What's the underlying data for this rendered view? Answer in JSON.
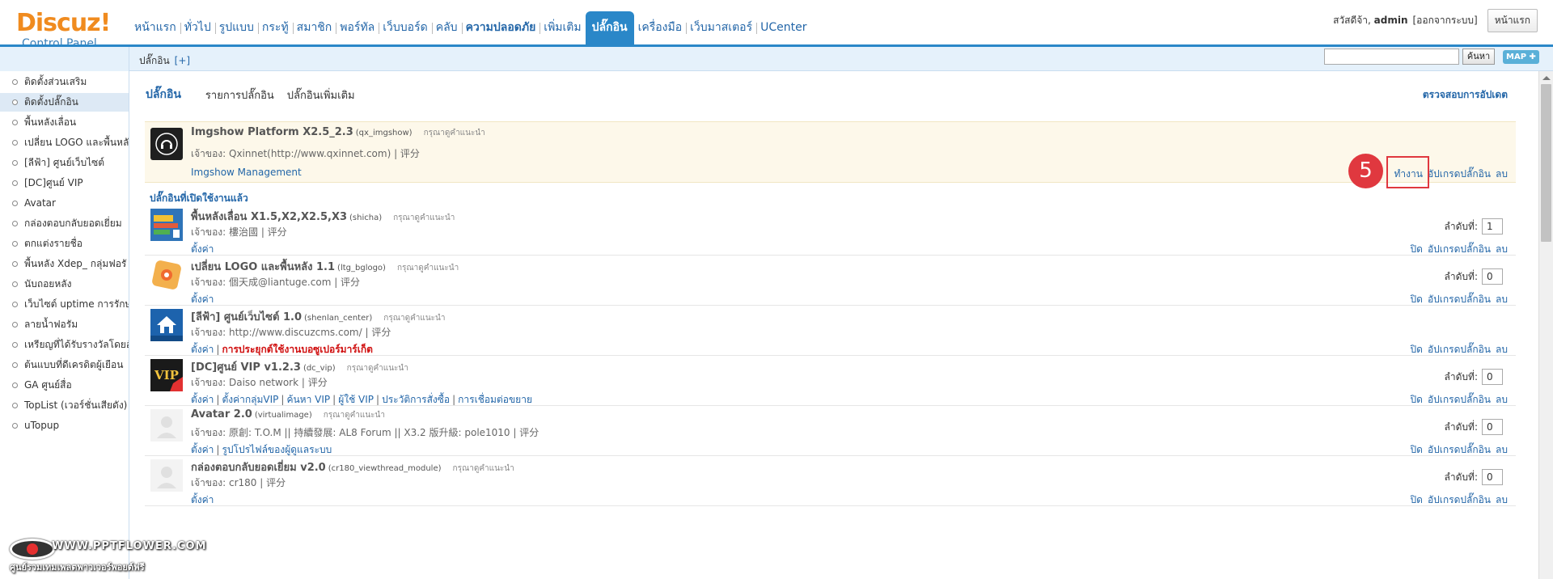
{
  "header": {
    "logo_main": "Discuz!",
    "logo_sub": "Control Panel",
    "nav": [
      {
        "label": "หน้าแรก",
        "style": ""
      },
      {
        "label": "ทั่วไป",
        "style": ""
      },
      {
        "label": "รูปแบบ",
        "style": ""
      },
      {
        "label": "กระทู้",
        "style": ""
      },
      {
        "label": "สมาชิก",
        "style": ""
      },
      {
        "label": "พอร์ทัล",
        "style": ""
      },
      {
        "label": "เว็บบอร์ด",
        "style": ""
      },
      {
        "label": "คลับ",
        "style": ""
      },
      {
        "label": "ความปลอดภัย",
        "style": "bold"
      },
      {
        "label": "เพิ่มเติม",
        "style": ""
      },
      {
        "label": "ปลั๊กอิน",
        "style": "active"
      },
      {
        "label": "เครื่องมือ",
        "style": ""
      },
      {
        "label": "เว็บมาสเตอร์",
        "style": ""
      },
      {
        "label": "UCenter",
        "style": ""
      }
    ],
    "greeting_prefix": "สวัสดีจ้า, ",
    "username": "admin",
    "logout": "[ออกจากระบบ]",
    "home_button": "หน้าแรก"
  },
  "subbar": {
    "title": "ปลั๊กอิน",
    "add": "[+]",
    "search_button": "ค้นหา",
    "map_button": "MAP ✚",
    "search_value": ""
  },
  "sidebar": {
    "items": [
      {
        "label": "ติดตั้งส่วนเสริม",
        "active": false
      },
      {
        "label": "ติดตั้งปลั๊กอิน",
        "active": true
      },
      {
        "label": "พื้นหลังเลื่อน",
        "active": false
      },
      {
        "label": "เปลี่ยน LOGO และพื้นหลั",
        "active": false
      },
      {
        "label": "[ลีฟ้า] ศูนย์เว็บไซต์",
        "active": false
      },
      {
        "label": "[DC]ศูนย์ VIP",
        "active": false
      },
      {
        "label": "Avatar",
        "active": false
      },
      {
        "label": "กล่องตอบกลับยอดเยี่ยม",
        "active": false
      },
      {
        "label": "ตกแต่งรายชื่อ",
        "active": false
      },
      {
        "label": "พื้นหลัง Xdep_ กลุ่มฟอรั",
        "active": false
      },
      {
        "label": "นับถอยหลัง",
        "active": false
      },
      {
        "label": "เว็บไซต์ uptime การรักษ",
        "active": false
      },
      {
        "label": "ลายน้ำฟอรัม",
        "active": false
      },
      {
        "label": "เหรียญที่ได้รับรางวัลโดยอั",
        "active": false
      },
      {
        "label": "ต้นแบบที่ดีเครดิตผู้เยือน",
        "active": false
      },
      {
        "label": "GA ศูนย์สื่อ",
        "active": false
      },
      {
        "label": "TopList (เวอร์ชั่นเสียดัง)",
        "active": false
      },
      {
        "label": "uTopup",
        "active": false
      }
    ]
  },
  "main": {
    "tabs": [
      "ปลั๊กอิน",
      "รายการปลั๊กอิน",
      "ปลั๊กอินเพิ่มเติม"
    ],
    "check_updates": "ตรวจสอบการอัปเดต",
    "section_title": "ปลั๊กอินที่เปิดใช้งานแล้ว",
    "recommend_label": "กรุณาดูคำแนะนำ",
    "order_label": "ลำดับที่:",
    "featured": {
      "name": "Imgshow Platform X2.5_2.3",
      "id": "(qx_imgshow)",
      "owner": "เจ้าของ: Qxinnet(http://www.qxinnet.com) | 评分",
      "links": [
        "Imgshow Management"
      ],
      "actions": [
        "ทำงาน",
        "อัปเกรดปลั๊กอิน",
        "ลบ"
      ]
    },
    "plugins": [
      {
        "name": "พื้นหลังเลื่อน X1.5,X2,X2.5,X3",
        "id": "(shicha)",
        "owner": "เจ้าของ: 樓治國 | 评分",
        "links": [
          "ตั้งค่า"
        ],
        "red_link": "",
        "order": "1",
        "actions": [
          "ปิด",
          "อัปเกรดปลั๊กอิน",
          "ลบ"
        ]
      },
      {
        "name": "เปลี่ยน LOGO และพื้นหลัง 1.1",
        "id": "(ltg_bglogo)",
        "owner": "เจ้าของ: 個天成@liantuge.com | 评分",
        "links": [
          "ตั้งค่า"
        ],
        "red_link": "",
        "order": "0",
        "actions": [
          "ปิด",
          "อัปเกรดปลั๊กอิน",
          "ลบ"
        ]
      },
      {
        "name": "[ลีฟ้า] ศูนย์เว็บไซต์ 1.0",
        "id": "(shenlan_center)",
        "owner": "เจ้าของ: http://www.discuzcms.com/ | 评分",
        "links": [
          "ตั้งค่า"
        ],
        "red_link": "การประยุกต์ใช้งานบอซูเปอร์มาร์เก็ต",
        "order": "",
        "actions": [
          "ปิด",
          "อัปเกรดปลั๊กอิน",
          "ลบ"
        ]
      },
      {
        "name": "[DC]ศูนย์ VIP v1.2.3",
        "id": "(dc_vip)",
        "owner": "เจ้าของ: Daiso network | 评分",
        "links": [
          "ตั้งค่า",
          "ตั้งค่ากลุ่มVIP",
          "ค้นหา VIP",
          "ผู้ใช้ VIP",
          "ประวัติการสั่งซื้อ",
          "การเชื่อมต่อขยาย"
        ],
        "red_link": "",
        "order": "0",
        "actions": [
          "ปิด",
          "อัปเกรดปลั๊กอิน",
          "ลบ"
        ]
      },
      {
        "name": "Avatar 2.0",
        "id": "(virtualimage)",
        "owner": "เจ้าของ: 原創: T.O.M || 持續發展: AL8 Forum || X3.2 版升級: pole1010 | 评分",
        "links": [
          "ตั้งค่า",
          "รูปโปรไฟล์ของผู้ดูแลระบบ"
        ],
        "red_link": "",
        "order": "0",
        "actions": [
          "ปิด",
          "อัปเกรดปลั๊กอิน",
          "ลบ"
        ]
      },
      {
        "name": "กล่องตอบกลับยอดเยี่ยม v2.0",
        "id": "(cr180_viewthread_module)",
        "owner": "เจ้าของ: cr180 | 评分",
        "links": [
          "ตั้งค่า"
        ],
        "red_link": "",
        "order": "0",
        "actions": [
          "ปิด",
          "อัปเกรดปลั๊กอิน",
          "ลบ"
        ]
      }
    ]
  },
  "annotation": {
    "step_number": "5",
    "color": "#e0383f"
  },
  "watermark": {
    "line1": "WWW.PPTFLOWER.COM",
    "line2": "ศูนย์รวมเทมเพลตพาวเวอร์พอยต์ฟรี"
  },
  "colors": {
    "accent": "#2a87c8",
    "link": "#2366a8",
    "logo": "#f08b1f",
    "highlight_row": "#fdf8ea",
    "red_link": "#d01010"
  }
}
